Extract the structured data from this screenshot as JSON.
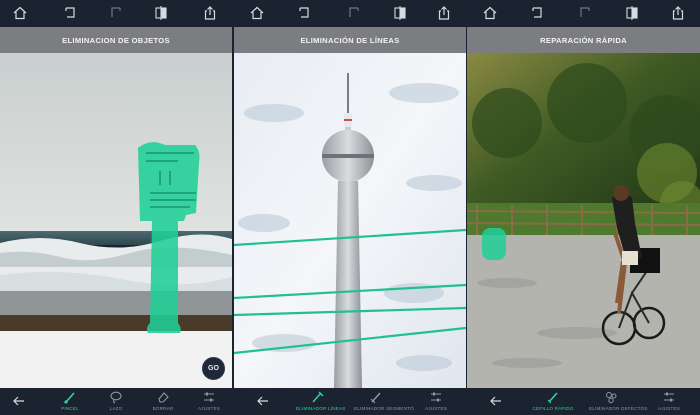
{
  "colors": {
    "accent": "#2fd3a2",
    "bar": "#1b2230",
    "title_bar": "#7b7d80",
    "inactive": "#8f96a3"
  },
  "panels": [
    {
      "title": "ELIMINACION DE OBJETOS",
      "go_label": "GO",
      "tools": [
        {
          "label": "PINCEL",
          "icon": "brush-icon",
          "active": true
        },
        {
          "label": "LAZO",
          "icon": "lasso-icon",
          "active": false
        },
        {
          "label": "BORRAR",
          "icon": "eraser-icon",
          "active": false
        },
        {
          "label": "AJUSTES",
          "icon": "sliders-icon",
          "active": false
        }
      ]
    },
    {
      "title": "ELIMINACIÓN DE LÍNEAS",
      "tools": [
        {
          "label": "ELIMINADOR LÍNEAS",
          "icon": "line-remover-icon",
          "active": true
        },
        {
          "label": "ELIMINADOR SEGMENTO",
          "icon": "segment-remover-icon",
          "active": false
        },
        {
          "label": "AJUSTES",
          "icon": "sliders-icon",
          "active": false
        }
      ]
    },
    {
      "title": "REPARACIÓN RÁPIDA",
      "tools": [
        {
          "label": "CEPILLO RÁPIDO",
          "icon": "quick-brush-icon",
          "active": true
        },
        {
          "label": "ELIMINADOR DEFECTOS",
          "icon": "blemish-remover-icon",
          "active": false
        },
        {
          "label": "AJUSTES",
          "icon": "sliders-icon",
          "active": false
        }
      ]
    }
  ],
  "topbar_icons": [
    "home-icon",
    "undo-icon",
    "redo-icon",
    "compare-icon",
    "share-icon"
  ]
}
